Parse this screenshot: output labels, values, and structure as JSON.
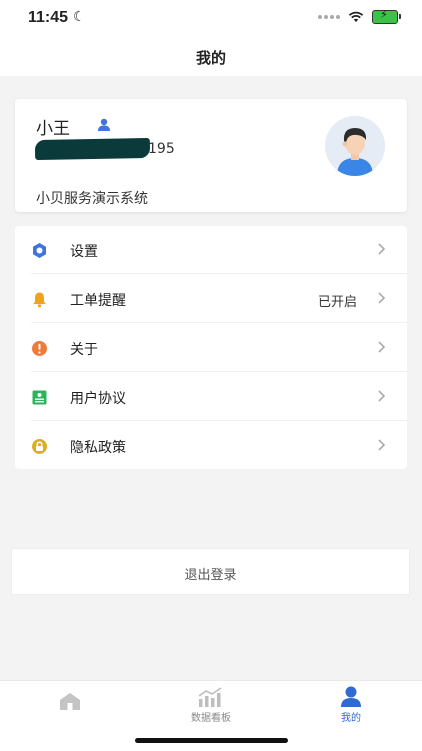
{
  "status_bar": {
    "time": "11:45"
  },
  "nav": {
    "title": "我的"
  },
  "profile": {
    "name": "小王",
    "phone_visible": "195",
    "company": "小贝服务演示系统"
  },
  "menu": [
    {
      "label": "设置",
      "value": "",
      "icon": "gear-icon",
      "color": "#3e74e0"
    },
    {
      "label": "工单提醒",
      "value": "已开启",
      "icon": "bell-icon",
      "color": "#f0a31a"
    },
    {
      "label": "关于",
      "value": "",
      "icon": "info-icon",
      "color": "#ee7b3a"
    },
    {
      "label": "用户协议",
      "value": "",
      "icon": "document-icon",
      "color": "#2db35e"
    },
    {
      "label": "隐私政策",
      "value": "",
      "icon": "lock-icon",
      "color": "#d9b21a"
    }
  ],
  "logout": {
    "label": "退出登录"
  },
  "tabbar": {
    "tabs": [
      {
        "label": "",
        "icon": "home-icon",
        "active": false
      },
      {
        "label": "数据看板",
        "icon": "chart-icon",
        "active": false
      },
      {
        "label": "我的",
        "icon": "person-icon",
        "active": true
      }
    ],
    "active_color": "#2f6bd6"
  }
}
